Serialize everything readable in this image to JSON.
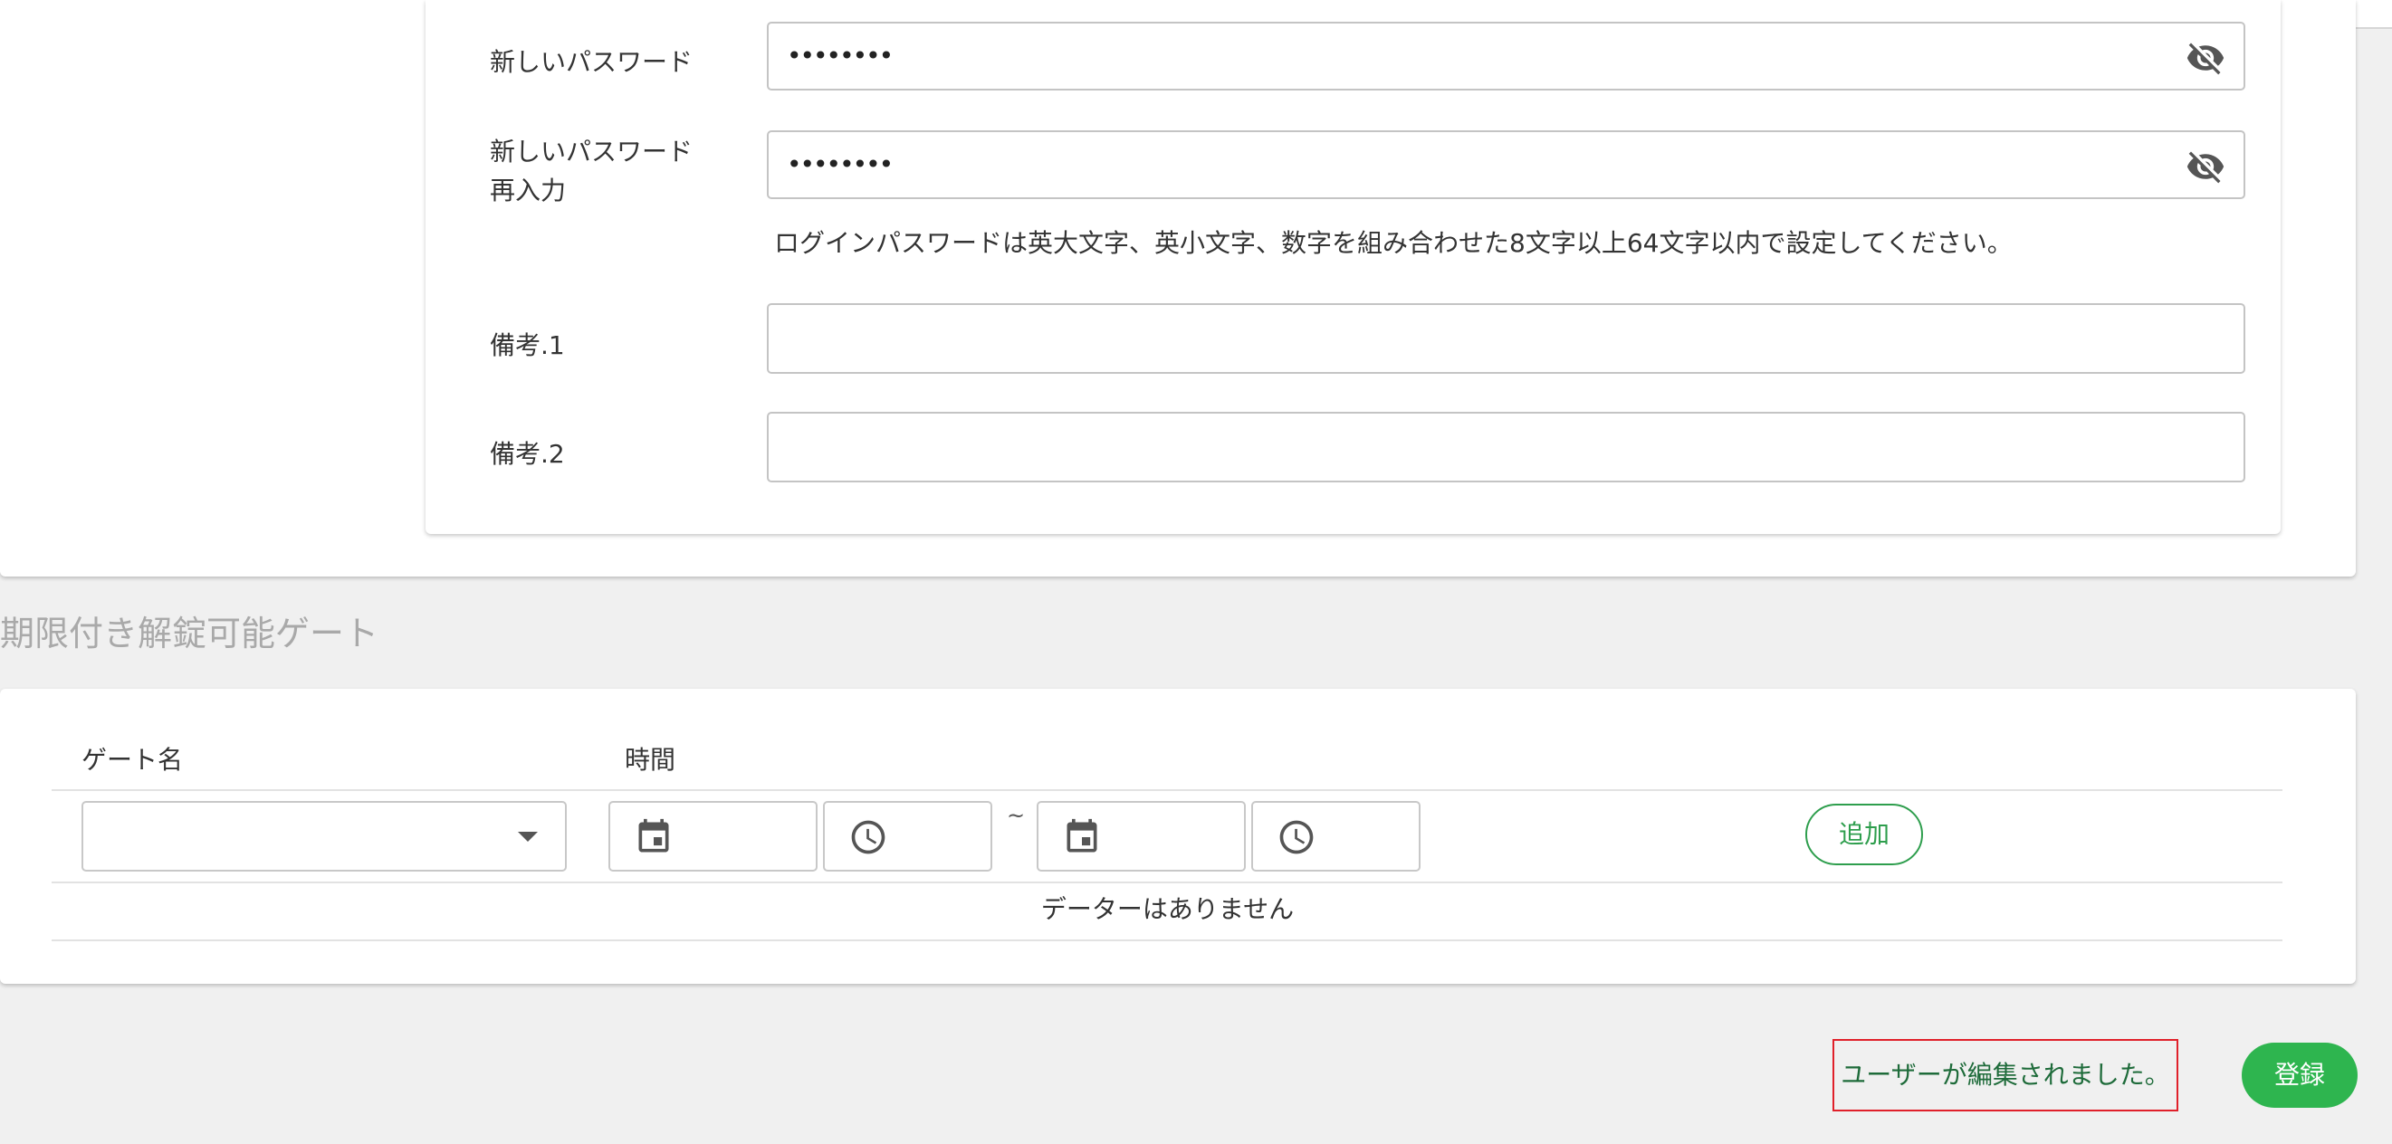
{
  "form": {
    "new_password_label": "新しいパスワード",
    "new_password_value": "••••••••",
    "new_password_confirm_label_line1": "新しいパスワード",
    "new_password_confirm_label_line2": "再入力",
    "new_password_confirm_value": "••••••••",
    "password_hint": "ログインパスワードは英大文字、英小文字、数字を組み合わせた8文字以上64文字以内で設定してください。",
    "remark1_label": "備考.1",
    "remark1_value": "",
    "remark2_label": "備考.2",
    "remark2_value": ""
  },
  "gates": {
    "section_title": "期限付き解錠可能ゲート",
    "col_gate_name": "ゲート名",
    "col_time": "時間",
    "gate_select_value": "",
    "range_separator": "~",
    "add_button": "追加",
    "empty_message": "データーはありません"
  },
  "footer": {
    "toast_message": "ユーザーが編集されました。",
    "submit_button": "登録"
  },
  "colors": {
    "accent_green": "#2eb54f",
    "toast_border": "#e0202a"
  },
  "icons": [
    "eye-off-icon",
    "calendar-icon",
    "clock-icon",
    "chevron-down-icon"
  ]
}
